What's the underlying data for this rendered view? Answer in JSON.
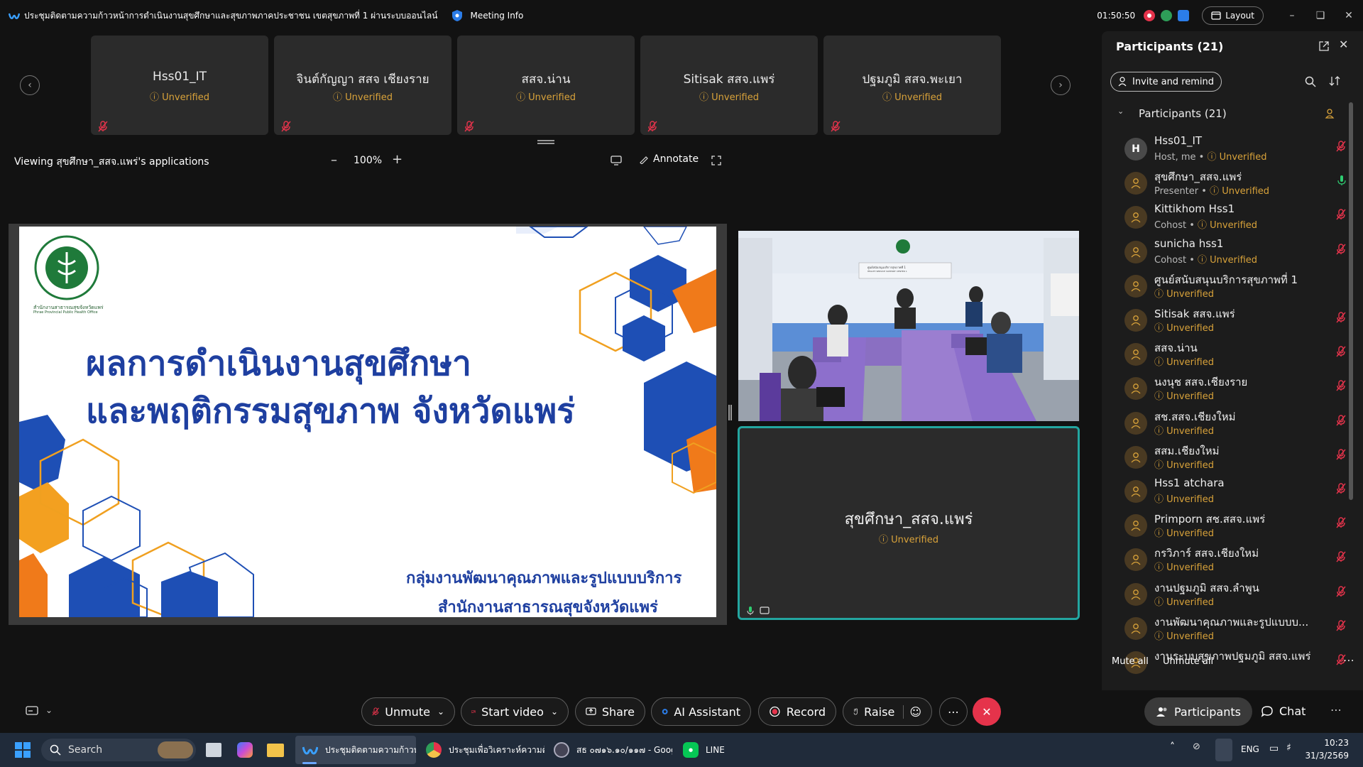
{
  "titlebar": {
    "meeting_title": "ประชุมติดตามความก้าวหน้าการดำเนินงานสุขศึกษาและสุขภาพภาคประชาชน เขตสุขภาพที่ 1 ผ่านระบบออนไลน์",
    "meeting_info": "Meeting Info",
    "timer": "01:50:50",
    "layout": "Layout"
  },
  "tiles": [
    {
      "name": "Hss01_IT",
      "status": "Unverified"
    },
    {
      "name": "จินต์กัญญา สสจ เชียงราย",
      "status": "Unverified"
    },
    {
      "name": "สสจ.น่าน",
      "status": "Unverified"
    },
    {
      "name": "Sitisak สสจ.แพร่",
      "status": "Unverified"
    },
    {
      "name": "ปฐมภูมิ สสจ.พะเยา",
      "status": "Unverified"
    }
  ],
  "viewbar": {
    "viewing": "Viewing สุขศึกษา_สสจ.แพร่'s applications",
    "zoom": "100%",
    "annotate": "Annotate"
  },
  "slide": {
    "title_line1": "ผลการดำเนินงานสุขศึกษา",
    "title_line2": "และพฤติกรรมสุขภาพ จังหวัดแพร่",
    "sub_line1": "กลุ่มงานพัฒนาคุณภาพและรูปแบบบริการ",
    "sub_line2": "สำนักงานสาธารณสุขจังหวัดแพร่",
    "logo_caption": "สำนักงานสาธารณสุขจังหวัดแพร่",
    "logo_caption_en": "Phrae Provincial Public Health Office",
    "logo_ring_text": "MINISTRY OF PUBLIC HEALTH"
  },
  "video": {
    "sign_line1": "ศูนย์สนับสนุนบริการสุขภาพที่ 1",
    "sign_line2": "HEALTH SERVICE SUPPORT CENTER 1"
  },
  "self_tile": {
    "name": "สุขศึกษา_สสจ.แพร่",
    "status": "Unverified"
  },
  "participants": {
    "header": "Participants (21)",
    "invite": "Invite and remind",
    "group_label": "Participants (21)",
    "mute_all": "Mute all",
    "unmute_all": "Unmute all",
    "list": [
      {
        "name": "Hss01_IT",
        "role": "Host, me",
        "status": "Unverified",
        "avatar": "H",
        "mic": "muted"
      },
      {
        "name": "สุขศึกษา_สสจ.แพร่",
        "role": "Presenter",
        "status": "Unverified",
        "avatar": "",
        "mic": "on"
      },
      {
        "name": "Kittikhom Hss1",
        "role": "Cohost",
        "status": "Unverified",
        "avatar": "",
        "mic": "muted"
      },
      {
        "name": "sunicha hss1",
        "role": "Cohost",
        "status": "Unverified",
        "avatar": "",
        "mic": "muted"
      },
      {
        "name": "ศูนย์สนับสนุนบริการสุขภาพที่ 1",
        "role": "",
        "status": "Unverified",
        "avatar": "",
        "mic": "none"
      },
      {
        "name": "Sitisak สสจ.แพร่",
        "role": "",
        "status": "Unverified",
        "avatar": "",
        "mic": "muted"
      },
      {
        "name": "สสจ.น่าน",
        "role": "",
        "status": "Unverified",
        "avatar": "",
        "mic": "muted"
      },
      {
        "name": "นงนุช สสจ.เชียงราย",
        "role": "",
        "status": "Unverified",
        "avatar": "",
        "mic": "muted"
      },
      {
        "name": "สช.สสจ.เชียงใหม่",
        "role": "",
        "status": "Unverified",
        "avatar": "",
        "mic": "muted"
      },
      {
        "name": "สสม.เชียงใหม่",
        "role": "",
        "status": "Unverified",
        "avatar": "",
        "mic": "muted"
      },
      {
        "name": "Hss1 atchara",
        "role": "",
        "status": "Unverified",
        "avatar": "",
        "mic": "muted"
      },
      {
        "name": "Primporn สช.สสจ.แพร่",
        "role": "",
        "status": "Unverified",
        "avatar": "",
        "mic": "muted"
      },
      {
        "name": "กรวิภาร์ สสจ.เชียงใหม่",
        "role": "",
        "status": "Unverified",
        "avatar": "",
        "mic": "muted"
      },
      {
        "name": "งานปฐมภูมิ สสจ.ลำพูน",
        "role": "",
        "status": "Unverified",
        "avatar": "",
        "mic": "muted"
      },
      {
        "name": "งานพัฒนาคุณภาพและรูปแบบบ...",
        "role": "",
        "status": "Unverified",
        "avatar": "",
        "mic": "muted"
      },
      {
        "name": "งานระบบสุขภาพปฐมภูมิ สสจ.แพร่",
        "role": "",
        "status": "",
        "avatar": "",
        "mic": "muted"
      }
    ]
  },
  "toolbar": {
    "unmute": "Unmute",
    "start_video": "Start video",
    "share": "Share",
    "ai": "AI Assistant",
    "record": "Record",
    "raise": "Raise",
    "participants": "Participants",
    "chat": "Chat"
  },
  "taskbar": {
    "search": "Search",
    "app1": "ประชุมติดตามความก้าวหน้า",
    "app2": "ประชุมเพื่อวิเคราะห์ความต้อง",
    "app3": "สธ ๐๗๑๖.๑๐/๑๑๗ - Goog",
    "app4": "LINE",
    "lang": "ENG",
    "time": "10:23",
    "date": "31/3/2569"
  },
  "colors": {
    "accent_teal": "#23a6a0",
    "unverified": "#d8a23a",
    "muted_red": "#e5334b",
    "slide_blue": "#1e3fa0",
    "end_red": "#e5334b"
  }
}
